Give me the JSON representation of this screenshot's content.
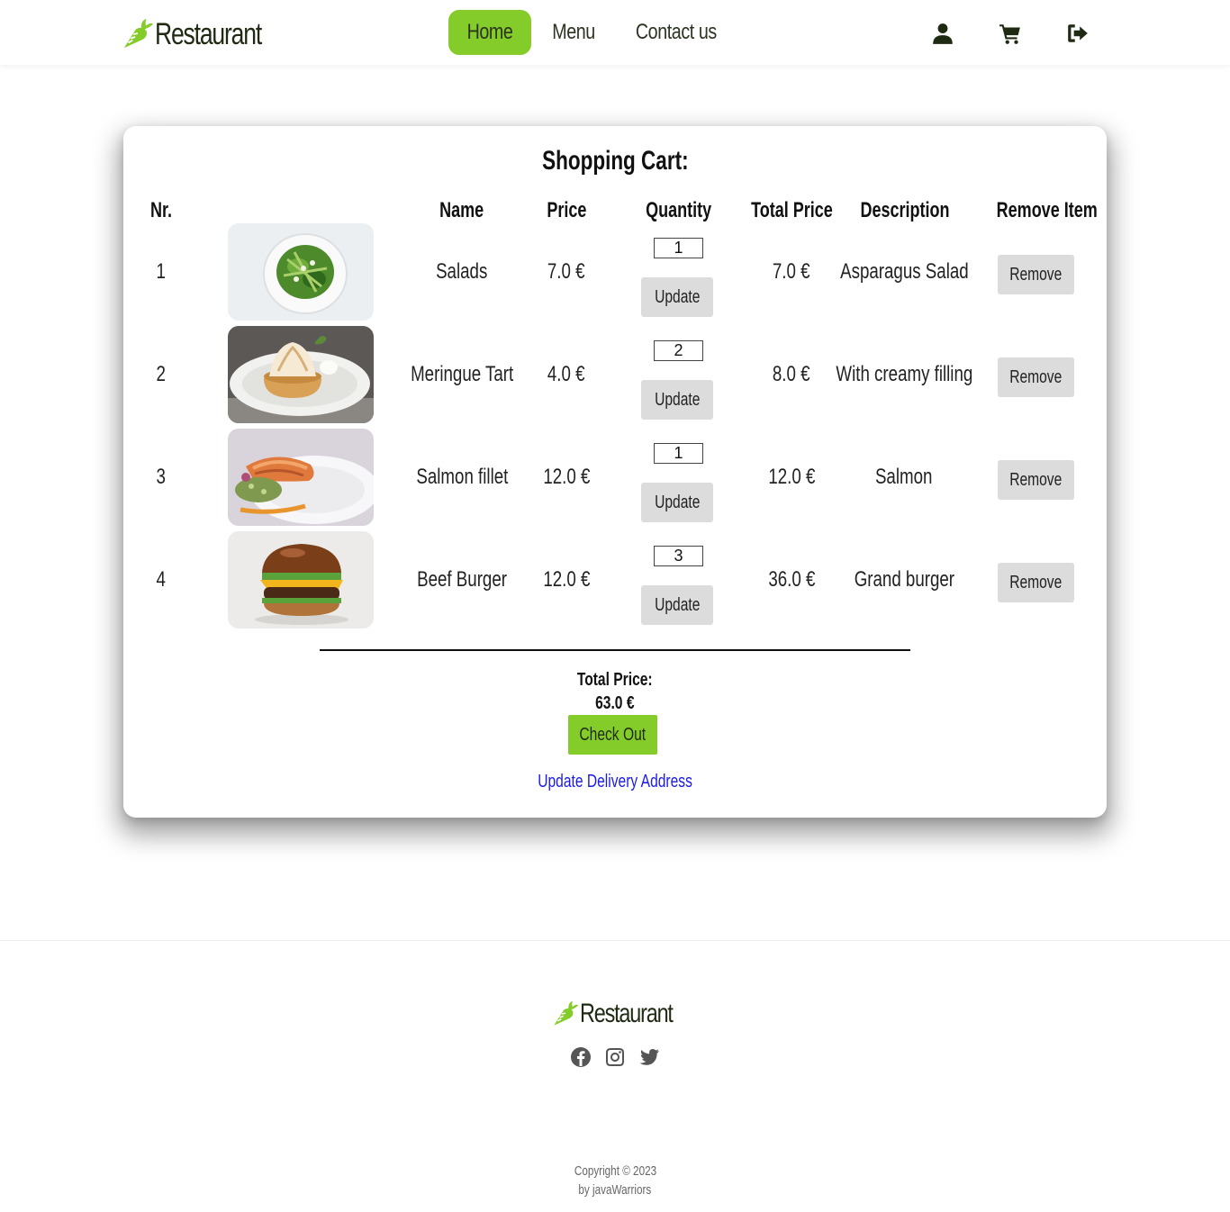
{
  "nav": {
    "brand": "Restaurant",
    "links": [
      "Home",
      "Menu",
      "Contact us"
    ],
    "icons": [
      "user-icon",
      "cart-icon",
      "logout-icon"
    ],
    "accent": "#84cc2a"
  },
  "cart": {
    "title": "Shopping Cart:",
    "headers": {
      "nr": "Nr.",
      "name": "Name",
      "price": "Price",
      "quantity": "Quantity",
      "total_price": "Total Price",
      "description": "Description",
      "remove_item": "Remove Item"
    },
    "items": [
      {
        "nr": "1",
        "image": "salad-plate-image",
        "name": "Salads",
        "price": "7.0 €",
        "quantity": "1",
        "total": "7.0 €",
        "description": "Asparagus Salad"
      },
      {
        "nr": "2",
        "image": "meringue-tart-image",
        "name": "Meringue Tart",
        "price": "4.0 €",
        "quantity": "2",
        "total": "8.0 €",
        "description": "With creamy filling"
      },
      {
        "nr": "3",
        "image": "salmon-fillet-image",
        "name": "Salmon fillet",
        "price": "12.0 €",
        "quantity": "1",
        "total": "12.0 €",
        "description": "Salmon"
      },
      {
        "nr": "4",
        "image": "beef-burger-image",
        "name": "Beef Burger",
        "price": "12.0 €",
        "quantity": "3",
        "total": "36.0 €",
        "description": "Grand burger"
      }
    ],
    "update_label": "Update",
    "remove_label": "Remove",
    "total_label": "Total Price:",
    "total_value": "63.0 €",
    "checkout_label": "Check Out",
    "address_link": "Update Delivery Address"
  },
  "footer": {
    "brand": "Restaurant",
    "socials": [
      "facebook-icon",
      "instagram-icon",
      "twitter-icon"
    ],
    "copyright": "Copyright © 2023",
    "author": "by javaWarriors"
  }
}
